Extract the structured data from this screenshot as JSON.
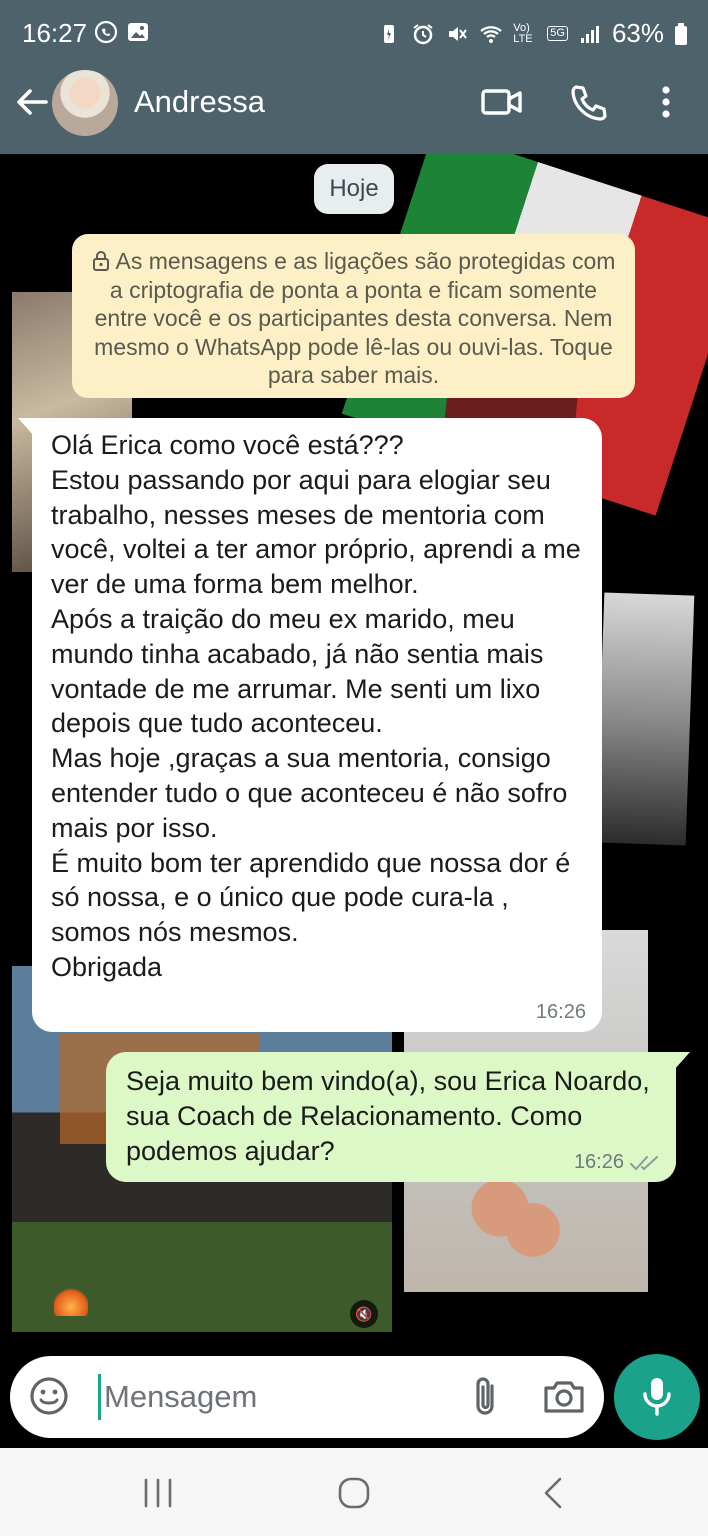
{
  "status_bar": {
    "time": "16:27",
    "battery_percent": "63%",
    "network": "5G",
    "volte": "Vo) LTE"
  },
  "header": {
    "contact_name": "Andressa",
    "icons": [
      "back-arrow-icon",
      "video-call-icon",
      "phone-call-icon",
      "more-vert-icon"
    ]
  },
  "chat": {
    "date_chip": "Hoje",
    "encryption_notice": "As mensagens e as ligações são protegidas com a criptografia de ponta a ponta e ficam somente entre você e os participantes desta conversa. Nem mesmo o WhatsApp pode lê-las ou ouvi-las. Toque para saber mais.",
    "messages": [
      {
        "direction": "incoming",
        "text": "Olá Erica como você está???\nEstou passando por aqui para elogiar seu trabalho, nesses meses de mentoria com você,  voltei a ter amor próprio, aprendi a me ver de uma forma bem melhor.\nApós a traição do meu ex marido,  meu mundo tinha acabado,  já não sentia mais vontade de me arrumar. Me senti um lixo depois que tudo aconteceu.\nMas hoje ,graças a sua mentoria, consigo entender tudo o que aconteceu é não sofro mais por isso.\nÉ muito bom ter aprendido que nossa dor é só nossa, e o único que pode cura-la , somos nós mesmos.\nObrigada",
        "time": "16:26"
      },
      {
        "direction": "outgoing",
        "text": "Seja muito bem vindo(a), sou Erica Noardo, sua Coach de Relacionamento. Como podemos ajudar?",
        "time": "16:26",
        "status": "read-double-check"
      }
    ]
  },
  "composer": {
    "placeholder": "Mensagem"
  },
  "colors": {
    "header": "#4e626c",
    "accent": "#1aa38a",
    "outgoing_bubble": "#dcf8c6",
    "notice_bg": "#fdf0c7"
  }
}
